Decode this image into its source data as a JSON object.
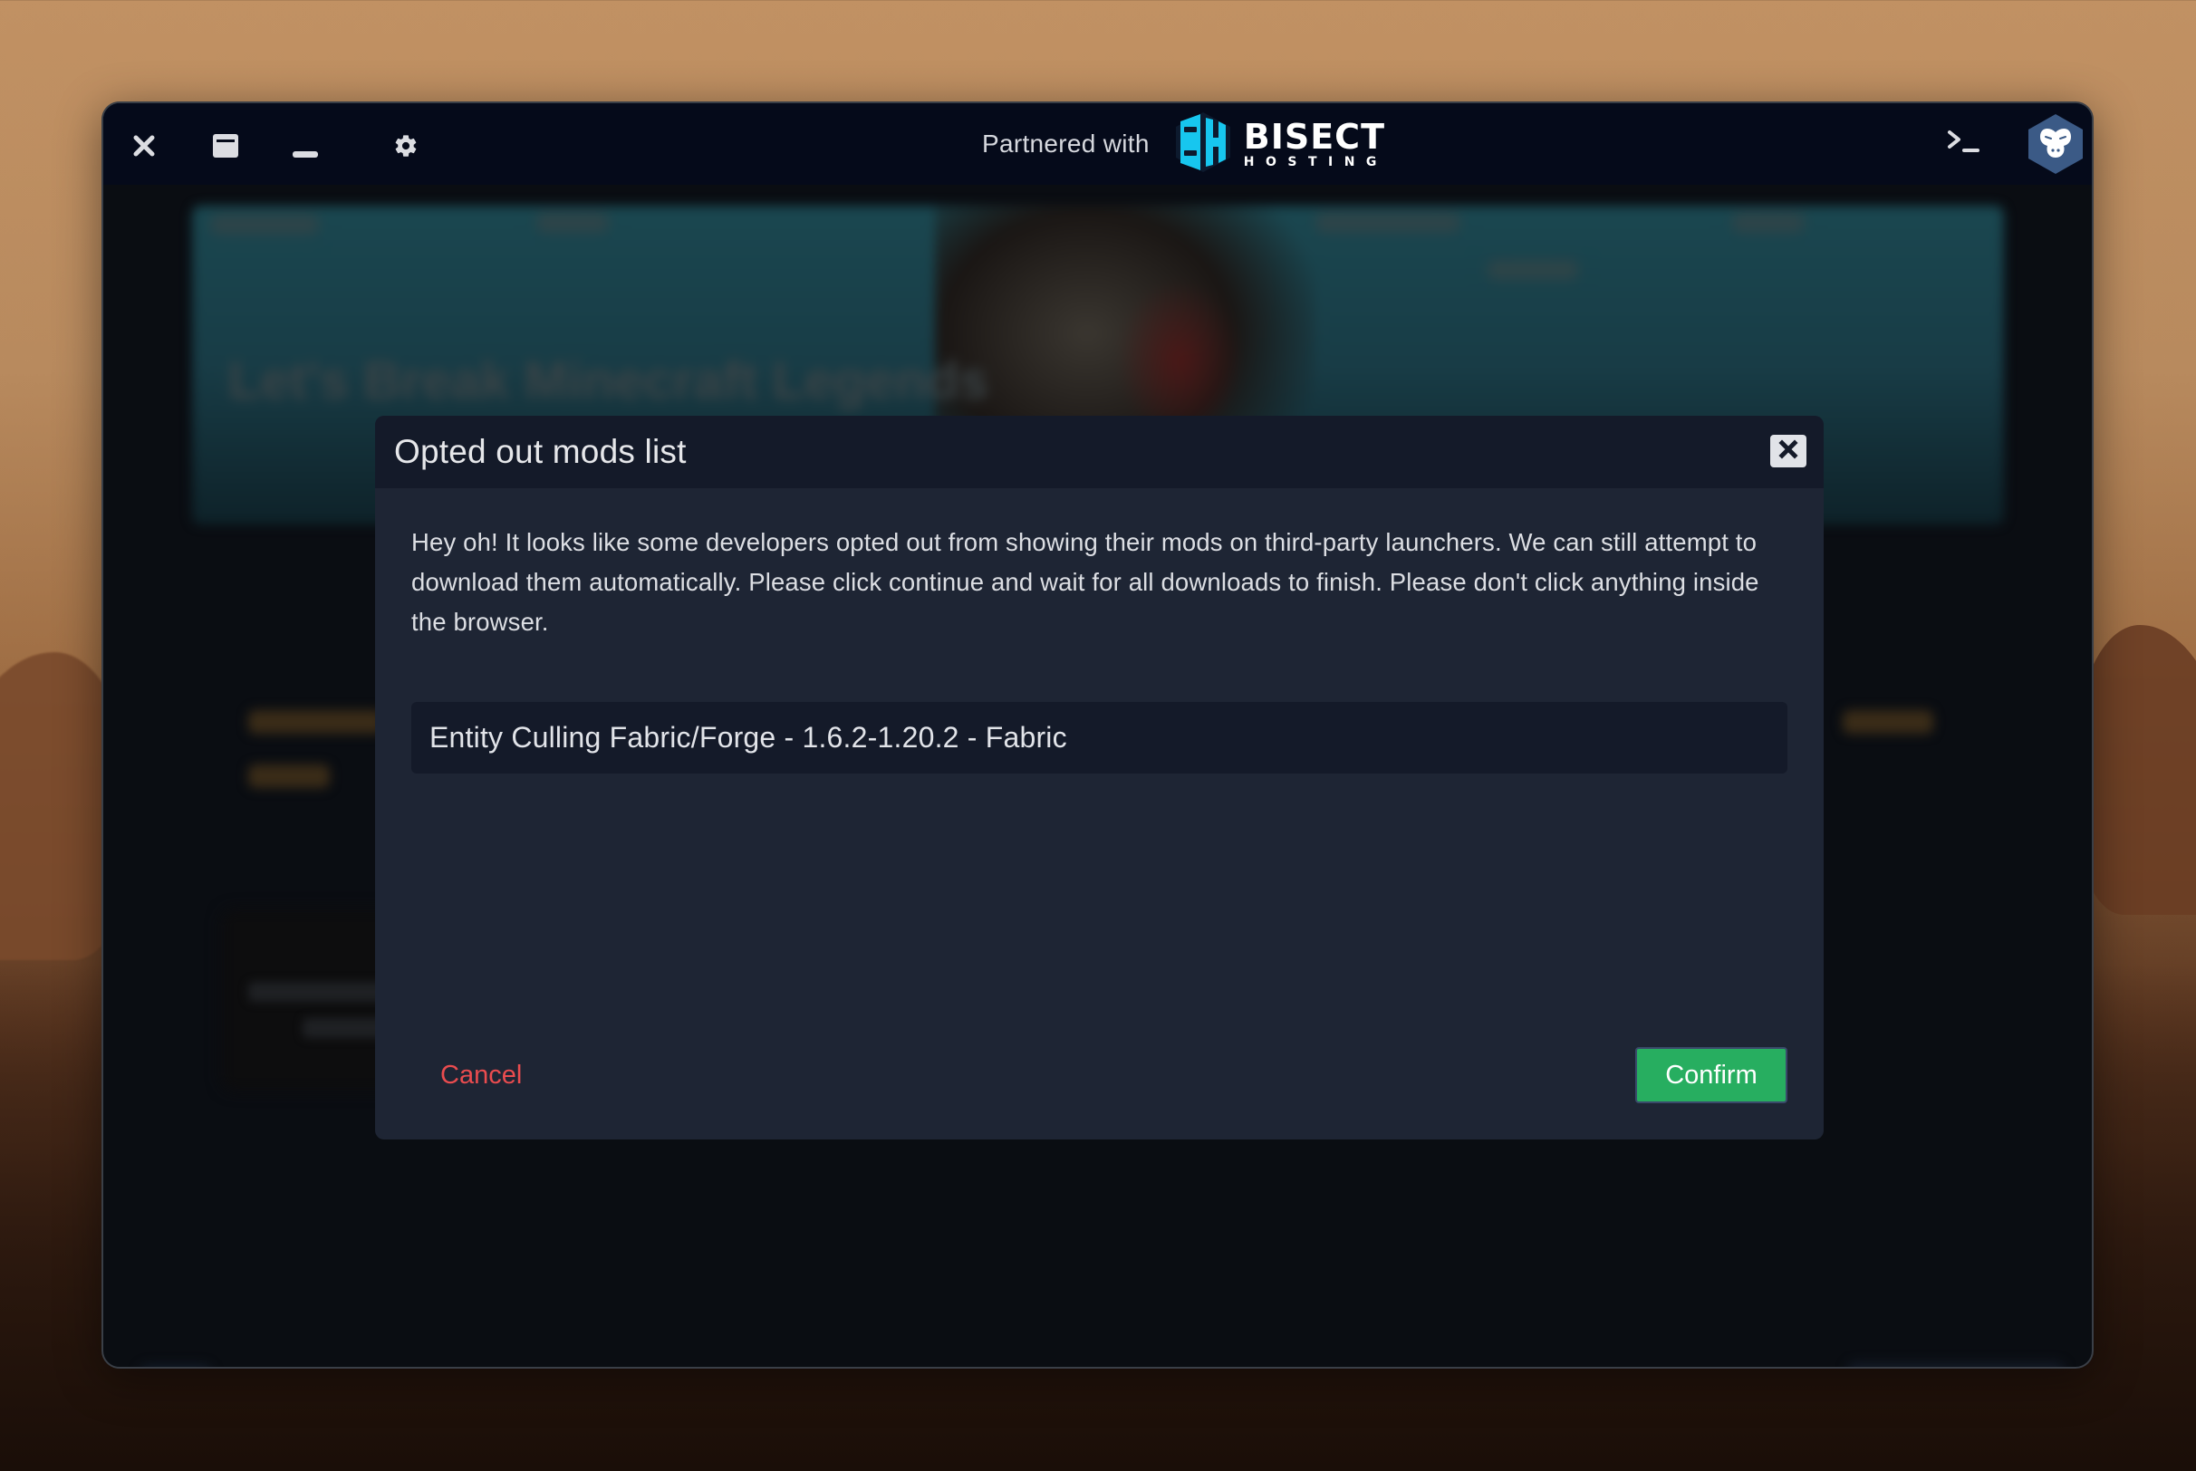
{
  "window": {
    "titlebar": {
      "buttons": [
        {
          "name": "close",
          "icon": "close-icon"
        },
        {
          "name": "maximize",
          "icon": "window-maximize-icon"
        },
        {
          "name": "minimize",
          "icon": "minimize-icon"
        },
        {
          "name": "settings",
          "icon": "gear-icon"
        }
      ],
      "partner_label": "Partnered with",
      "partner_brand": {
        "name": "BISECT",
        "subtitle": "HOSTING",
        "accent": "#17c6ef"
      },
      "terminal_icon": "terminal-icon",
      "avatar_icon": "monkey-hex-icon",
      "avatar_color": "#3b5a86"
    },
    "background": {
      "banner_title": "Let's Break Minecraft Legends"
    }
  },
  "modal": {
    "title": "Opted out mods list",
    "close_icon": "close-icon",
    "message": "Hey oh! It looks like some developers opted out from showing their mods on third-party launchers. We can still attempt to download them automatically. Please click continue and wait for all downloads to finish. Please don't click anything inside the browser.",
    "mods": [
      {
        "label": "Entity Culling Fabric/Forge - 1.6.2-1.20.2 - Fabric"
      }
    ],
    "cancel_label": "Cancel",
    "confirm_label": "Confirm",
    "colors": {
      "cancel": "#ea4c4f",
      "confirm": "#27ae60",
      "header_bg": "#141a29",
      "body_bg": "#1e2534"
    }
  }
}
